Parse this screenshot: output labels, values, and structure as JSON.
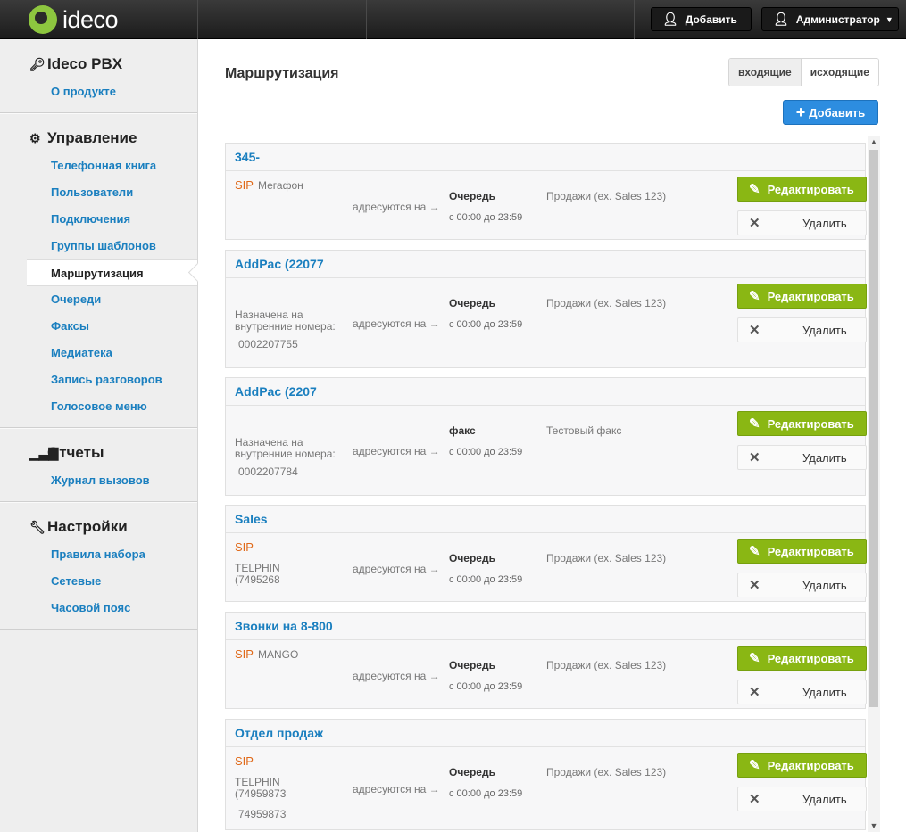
{
  "topbar": {
    "logo": "ideco",
    "add_label": "Добавить",
    "admin_label": "Администратор"
  },
  "sidebar": {
    "sections": [
      {
        "title": "Ideco PBX",
        "icon": "key-icon",
        "items": [
          "О продукте"
        ]
      },
      {
        "title": "Управление",
        "icon": "gear-icon",
        "items": [
          "Телефонная книга",
          "Пользователи",
          "Подключения",
          "Группы шаблонов",
          "Маршрутизация",
          "Очереди",
          "Факсы",
          "Медиатека",
          "Запись разговоров",
          "Голосовое меню"
        ]
      },
      {
        "title": "Отчеты",
        "icon": "bar-chart-icon",
        "items": [
          "Журнал вызовов"
        ]
      },
      {
        "title": "Настройки",
        "icon": "wrench-icon",
        "items": [
          "Правила набора",
          "Сетевые",
          "Часовой пояс"
        ]
      }
    ],
    "active_item": "Маршрутизация"
  },
  "main": {
    "title": "Маршрутизация",
    "tabs": [
      "входящие",
      "исходящие"
    ],
    "active_tab": "входящие",
    "add_label": "Добавить",
    "address_label": "адресуются на",
    "edit_label": "Редактировать",
    "delete_label": "Удалить",
    "routes": [
      {
        "name": "345-",
        "type": "SIP",
        "source": "Мегафон",
        "target": "Очередь",
        "time": "с 00:00 до 23:59",
        "description": "Продажи (ex. Sales 123)"
      },
      {
        "name": "AddPac (22077",
        "type": "",
        "source": "Назначена на\nвнутренние номера:",
        "number": "0002207755",
        "target": "Очередь",
        "time": "с 00:00 до 23:59",
        "description": "Продажи (ex. Sales 123)"
      },
      {
        "name": "AddPac (2207",
        "type": "",
        "source": "Назначена на\nвнутренние номера:",
        "number": "0002207784",
        "target": "факс",
        "time": "с 00:00 до 23:59",
        "description": "Тестовый факс"
      },
      {
        "name": "Sales",
        "type": "SIP",
        "source": "TELPHIN\n(7495268",
        "target": "Очередь",
        "time": "с 00:00 до 23:59",
        "description": "Продажи (ex. Sales 123)"
      },
      {
        "name": "Звонки на 8-800",
        "type": "SIP",
        "source": "MANGO",
        "target": "Очередь",
        "time": "с 00:00 до 23:59",
        "description": "Продажи (ex. Sales 123)"
      },
      {
        "name": "Отдел продаж",
        "type": "SIP",
        "source": "TELPHIN\n(74959873",
        "number": "74959873",
        "target": "Очередь",
        "time": "с 00:00 до 23:59",
        "description": "Продажи (ex. Sales 123)"
      }
    ]
  },
  "colors": {
    "accent_blue": "#2d8de0",
    "edit_green": "#8ab714",
    "sip_orange": "#e06a1a",
    "link_blue": "#1a7fbf"
  }
}
